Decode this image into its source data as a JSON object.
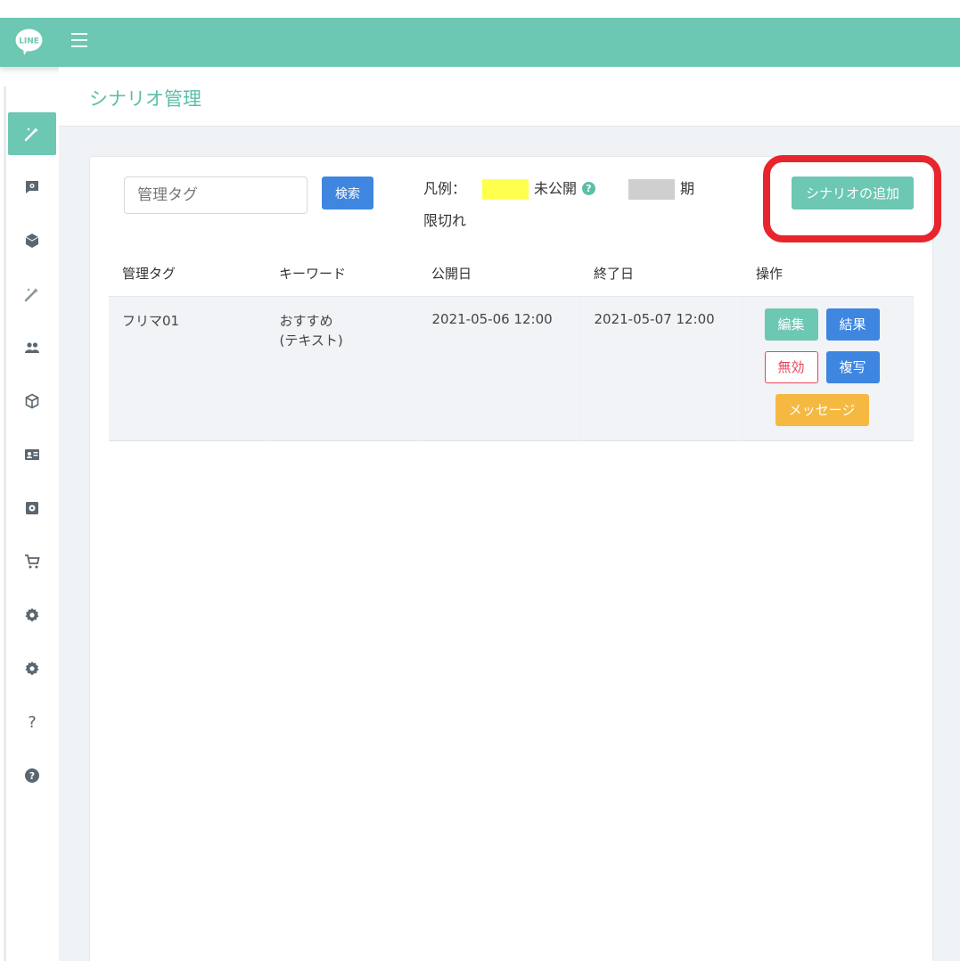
{
  "topbar": {
    "logo_text": "LINE",
    "menu_icon": "hamburger-icon",
    "background": "#6cc7b3"
  },
  "sidebar": {
    "items": [
      {
        "icon": "magic-wand-icon",
        "active": true
      },
      {
        "icon": "chat-gear-icon"
      },
      {
        "icon": "cube-filled-icon"
      },
      {
        "icon": "magic-wand-icon"
      },
      {
        "icon": "users-icon"
      },
      {
        "icon": "cube-outline-icon"
      },
      {
        "icon": "contact-card-icon"
      },
      {
        "icon": "gear-box-icon"
      },
      {
        "icon": "cart-icon"
      },
      {
        "icon": "gear-icon"
      },
      {
        "icon": "gear-icon"
      },
      {
        "icon": "question-mark-icon"
      },
      {
        "icon": "help-circle-icon"
      }
    ]
  },
  "page": {
    "title": "シナリオ管理"
  },
  "search": {
    "placeholder": "管理タグ",
    "button_label": "検索"
  },
  "legend": {
    "prefix": "凡例：",
    "unpublished_label": "未公開",
    "unpublished_color": "#ffff4d",
    "expired_label_part1": "期",
    "expired_label_part2": "限切れ",
    "expired_color": "#cfcfcf"
  },
  "add_button_label": "シナリオの追加",
  "table": {
    "headers": [
      "管理タグ",
      "キーワード",
      "公開日",
      "終了日",
      "操作"
    ],
    "rows": [
      {
        "tag": "フリマ01",
        "keyword_line1": "おすすめ",
        "keyword_line2": "(テキスト)",
        "published": "2021-05-06 12:00",
        "end": "2021-05-07 12:00"
      }
    ],
    "actions": {
      "edit": "編集",
      "result": "結果",
      "disable": "無効",
      "copy": "複写",
      "message": "メッセージ"
    }
  }
}
